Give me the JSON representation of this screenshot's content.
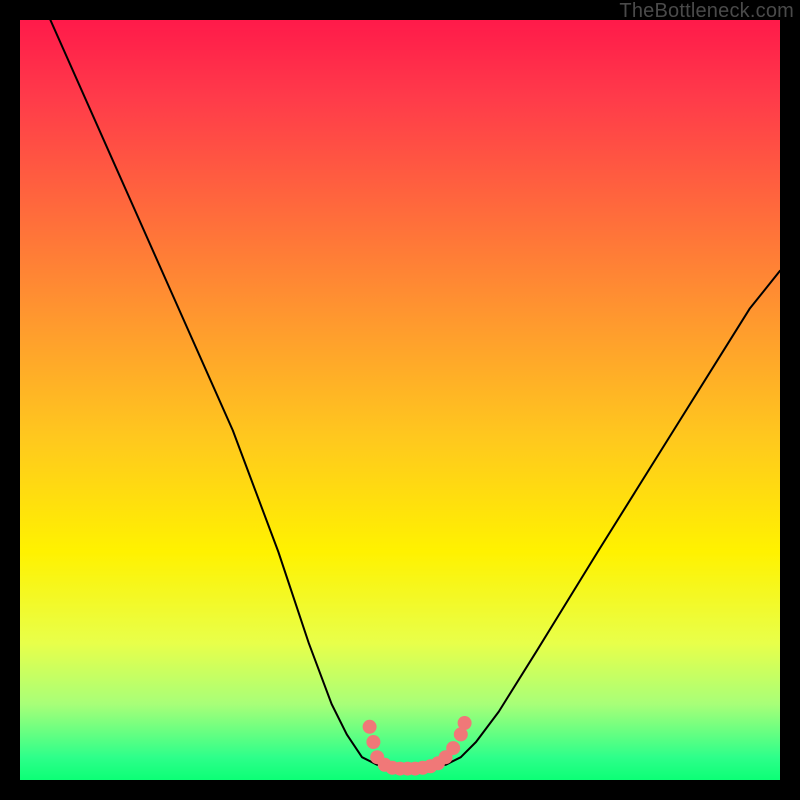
{
  "watermark": "TheBottleneck.com",
  "chart_data": {
    "type": "line",
    "title": "",
    "xlabel": "",
    "ylabel": "",
    "x_range": [
      0,
      100
    ],
    "y_range": [
      0,
      100
    ],
    "description": "V-shaped bottleneck curve descending from top-left, flattening at bottom center, rising toward right. Minimum near center indicates optimal pairing. Background hue encodes severity (red high, green low). Salmon dots highlight the flat minimum region.",
    "series": [
      {
        "name": "bottleneck-curve",
        "points_xy": [
          [
            4,
            100
          ],
          [
            12,
            82
          ],
          [
            20,
            64
          ],
          [
            28,
            46
          ],
          [
            34,
            30
          ],
          [
            38,
            18
          ],
          [
            41,
            10
          ],
          [
            43,
            6
          ],
          [
            45,
            3
          ],
          [
            47,
            2
          ],
          [
            50,
            1.5
          ],
          [
            53,
            1.5
          ],
          [
            56,
            2
          ],
          [
            58,
            3
          ],
          [
            60,
            5
          ],
          [
            63,
            9
          ],
          [
            68,
            17
          ],
          [
            76,
            30
          ],
          [
            86,
            46
          ],
          [
            96,
            62
          ],
          [
            100,
            67
          ]
        ]
      }
    ],
    "highlight_dots": [
      {
        "x": 46,
        "y": 7
      },
      {
        "x": 46.5,
        "y": 5
      },
      {
        "x": 47,
        "y": 3
      },
      {
        "x": 48,
        "y": 2
      },
      {
        "x": 49,
        "y": 1.6
      },
      {
        "x": 50,
        "y": 1.5
      },
      {
        "x": 51,
        "y": 1.5
      },
      {
        "x": 52,
        "y": 1.5
      },
      {
        "x": 53,
        "y": 1.6
      },
      {
        "x": 54,
        "y": 1.8
      },
      {
        "x": 55,
        "y": 2.2
      },
      {
        "x": 56,
        "y": 3
      },
      {
        "x": 57,
        "y": 4.2
      },
      {
        "x": 58,
        "y": 6
      },
      {
        "x": 58.5,
        "y": 7.5
      }
    ],
    "gradient_stops": [
      {
        "offset": 0,
        "color": "#ff1a4a"
      },
      {
        "offset": 10,
        "color": "#ff3a4a"
      },
      {
        "offset": 25,
        "color": "#ff6a3c"
      },
      {
        "offset": 40,
        "color": "#ff9a2e"
      },
      {
        "offset": 55,
        "color": "#ffc81e"
      },
      {
        "offset": 70,
        "color": "#fff200"
      },
      {
        "offset": 82,
        "color": "#e8ff4a"
      },
      {
        "offset": 90,
        "color": "#a8ff78"
      },
      {
        "offset": 97,
        "color": "#2eff8a"
      },
      {
        "offset": 100,
        "color": "#0cff76"
      }
    ]
  }
}
